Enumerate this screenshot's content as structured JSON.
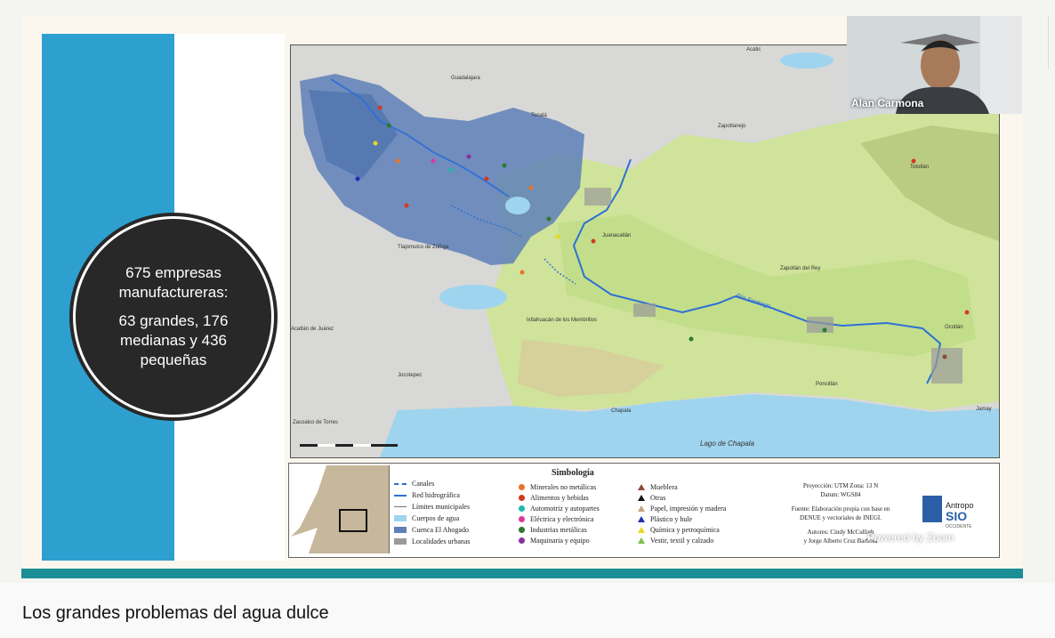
{
  "slide": {
    "circle_line1": "675 empresas",
    "circle_line2": "manufactureras:",
    "circle_line3": "63 grandes, 176",
    "circle_line4": "medianas y 436",
    "circle_line5": "pequeñas"
  },
  "map": {
    "places": {
      "guadalajara": "Guadalajara",
      "tonala": "Tonalá",
      "zapotlanejo": "Zapotlanejo",
      "acatic": "Acatic",
      "tototlan": "Tototlán",
      "juanacatlan": "Juanacatlán",
      "zapotlan_del_rey": "Zapotlán del Rey",
      "ixtlahuacan": "Ixtlahuacán de los Membrillos",
      "acatlan": "Acatlán de Juárez",
      "jocotepec": "Jocotepec",
      "zacoalco": "Zacoalco de Torres",
      "chapala": "Chapala",
      "poncitlan": "Poncitlán",
      "ocotlan": "Ocotlán",
      "jamay": "Jamay",
      "tlajomulco": "Tlajomulco de Zúñiga",
      "rio_santiago": "Río Santiago",
      "lago": "Lago de Chapala"
    }
  },
  "legend": {
    "title": "Simbología",
    "left": [
      "Canales",
      "Red hidrográfica",
      "Límites municipales",
      "Cuerpos de agua",
      "Cuenca El Ahogado",
      "Localidades urbanas"
    ],
    "middle": [
      "Minerales no metálicas",
      "Alimentos y bebidas",
      "Automotriz y autopartes",
      "Eléctrica y electrónica",
      "Industrias metálicas",
      "Maquinaria y equipo"
    ],
    "right": [
      "Mueblera",
      "Otras",
      "Papel, impresión y madera",
      "Plástico y hule",
      "Química y petroquímica",
      "Vestir, textil y calzado"
    ],
    "proj1": "Proyección: UTM   Zona: 13 N",
    "proj2": "Datum: WGS84",
    "src1": "Fuente: Elaboración propia con base en",
    "src2": "DENUE y vectoriales de INEGI.",
    "auth1": "Autores: Cindy McCulligh",
    "auth2": "y Jorge Alberto Cruz Barbosa",
    "logo_text": "Antropo",
    "logo_sub": "OCCIDENTE"
  },
  "colors": {
    "minerales": "#e8742a",
    "alimentos": "#d6391e",
    "automotriz": "#1fb8b0",
    "electrica": "#d93aa0",
    "metalicas": "#2b7a2b",
    "maquinaria": "#8b2fa0",
    "mueblera": "#8b4a3a",
    "otras": "#111111",
    "papel": "#c8a07a",
    "plastico": "#2030b0",
    "quimica": "#e8d820",
    "vestir": "#7ac04a"
  },
  "participant": {
    "name": "Alan Carmona"
  },
  "overlay": {
    "zoom": "Powered by Zoom"
  },
  "caption": "Los grandes problemas del agua dulce"
}
